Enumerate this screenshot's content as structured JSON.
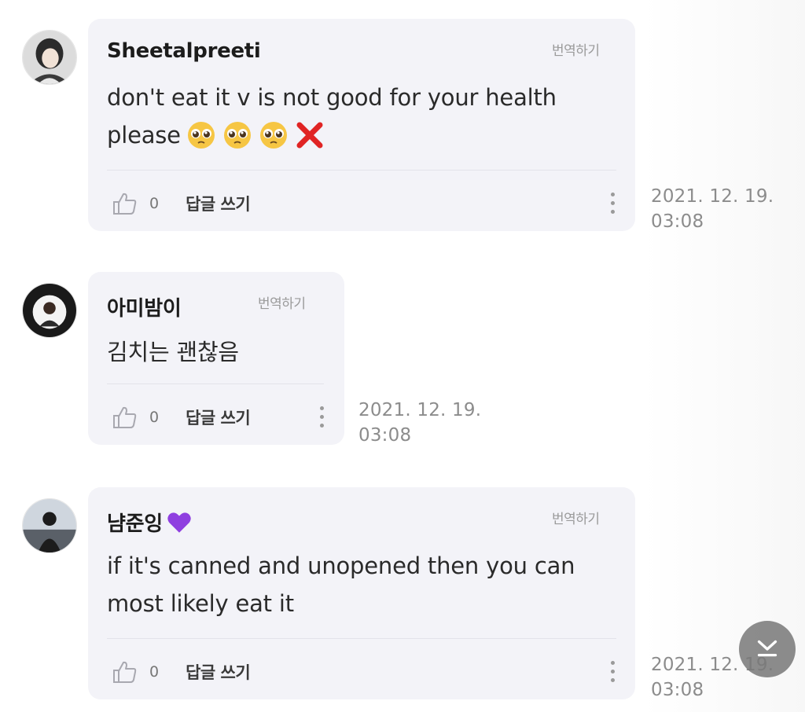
{
  "comments": [
    {
      "author": "Sheetalpreeti",
      "translate_label": "번역하기",
      "text_lines": [
        "don't eat it v is not good for your health",
        "please"
      ],
      "emojis": [
        "pleading-face",
        "pleading-face",
        "pleading-face",
        "red-cross-mark"
      ],
      "like_count": "0",
      "reply_label": "답글 쓰기",
      "date": "2021. 12. 19.",
      "time": "03:08"
    },
    {
      "author": "아미밤이",
      "translate_label": "번역하기",
      "text_lines": [
        "김치는 괜찮음"
      ],
      "like_count": "0",
      "reply_label": "답글 쓰기",
      "date": "2021. 12. 19.",
      "time": "03:08"
    },
    {
      "author": "냠준잉",
      "author_emoji": "purple-heart",
      "translate_label": "번역하기",
      "text_lines": [
        "if it's canned and unopened then you can",
        "most likely eat it"
      ],
      "like_count": "0",
      "reply_label": "답글 쓰기",
      "date": "2021. 12. 19.",
      "time": "03:08"
    }
  ],
  "scroll_button_icon": "scroll-to-bottom-icon",
  "colors": {
    "bubble": "#f3f3f8",
    "meta_text": "#8c8c8c",
    "heart": "#8f3fe0",
    "cross": "#e02424"
  }
}
